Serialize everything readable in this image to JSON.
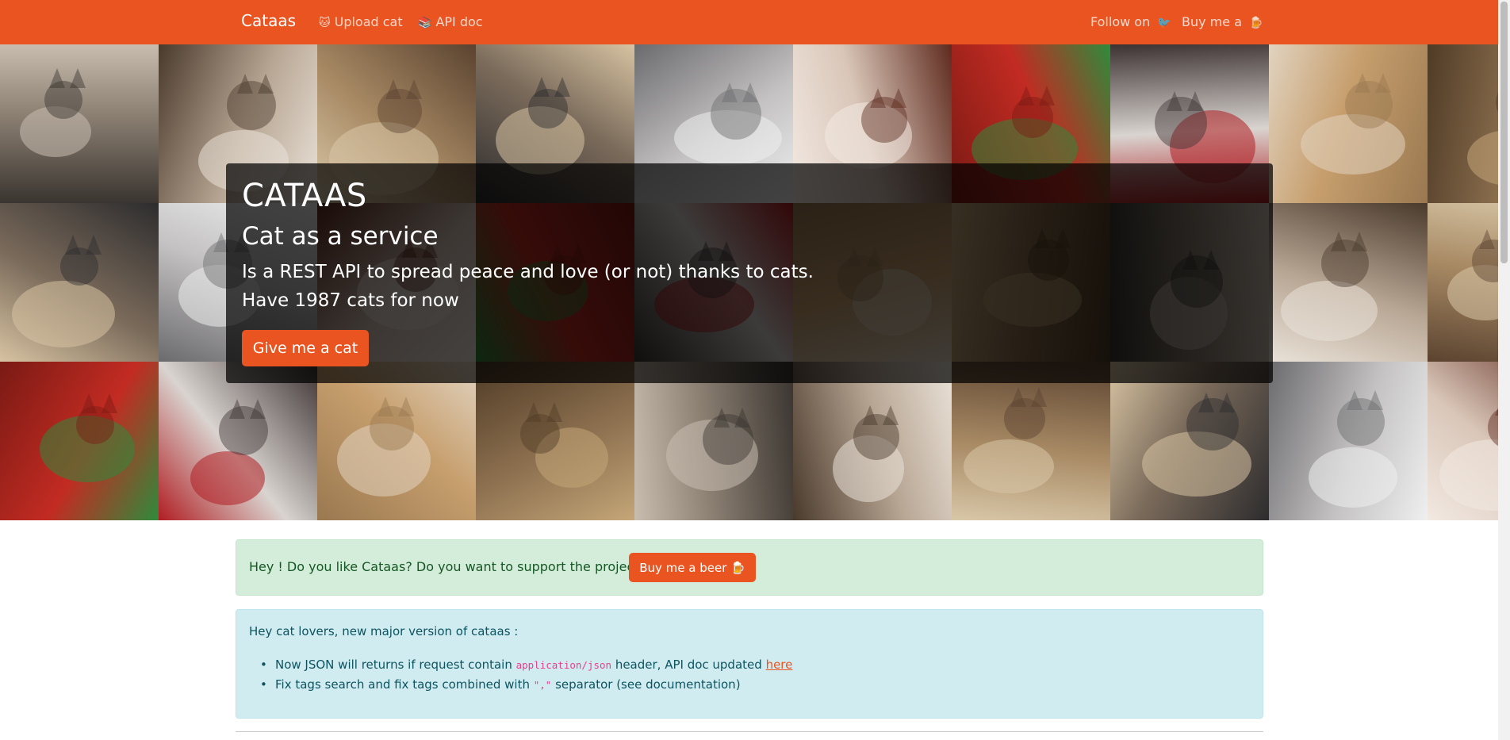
{
  "navbar": {
    "brand": "Cataas",
    "upload_label": "Upload cat",
    "upload_icon": "cat-face-icon",
    "apidoc_label": "API doc",
    "apidoc_icon": "book-icon",
    "follow_label": "Follow on",
    "follow_icon": "bird-icon",
    "buy_label": "Buy me a",
    "buy_icon": "beer-mug-icon",
    "color": "#e95420"
  },
  "hero": {
    "title": "CATAAS",
    "subtitle": "Cat as a service",
    "description": "Is a REST API to spread peace and love (or not) thanks to cats.",
    "count_text": "Have 1987 cats for now",
    "button_label": "Give me a cat"
  },
  "support_alert": {
    "text": "Hey ! Do you like Cataas? Do you want to support the project ?",
    "button_label": "Buy me a beer 🍺"
  },
  "info_alert": {
    "heading": "Hey cat lovers, new major version of cataas :",
    "item1_pre": "Now JSON will returns if request contain ",
    "item1_code": "application/json",
    "item1_mid": " header, API doc updated ",
    "item1_link": "here",
    "item2_pre": "Fix tags search and fix tags combined with ",
    "item2_code": "\",\"",
    "item2_post": " separator (see documentation)"
  },
  "colors": {
    "accent": "#e95420",
    "success_bg": "#d4edda",
    "info_bg": "#d1ecf1"
  }
}
